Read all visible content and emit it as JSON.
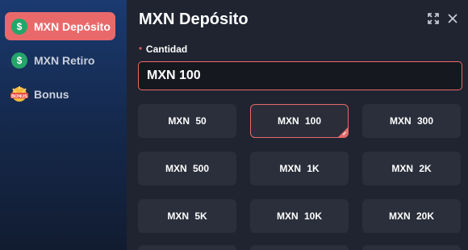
{
  "sidebar": {
    "items": [
      {
        "label": "MXN Depósito",
        "icon": "dollar-icon",
        "active": true
      },
      {
        "label": "MXN Retiro",
        "icon": "dollar-icon",
        "active": false
      },
      {
        "label": "Bonus",
        "icon": "bonus-icon",
        "active": false,
        "icon_text": "BONUS"
      }
    ]
  },
  "header": {
    "title": "MXN Depósito",
    "expand_icon": "expand-icon",
    "close_icon": "close-icon"
  },
  "form": {
    "required_mark": "*",
    "amount_label": "Cantidad",
    "amount_value": "MXN 100"
  },
  "options": [
    {
      "label": "MXN 50",
      "selected": false
    },
    {
      "label": "MXN 100",
      "selected": true
    },
    {
      "label": "MXN 300",
      "selected": false
    },
    {
      "label": "MXN 500",
      "selected": false
    },
    {
      "label": "MXN 1K",
      "selected": false
    },
    {
      "label": "MXN 2K",
      "selected": false
    },
    {
      "label": "MXN 5K",
      "selected": false
    },
    {
      "label": "MXN 10K",
      "selected": false
    },
    {
      "label": "MXN 20K",
      "selected": false
    }
  ],
  "colors": {
    "accent": "#e9696a",
    "dollar_icon": "#25a56a",
    "panel_bg": "#1f2430",
    "option_bg": "#2a2f3b"
  }
}
